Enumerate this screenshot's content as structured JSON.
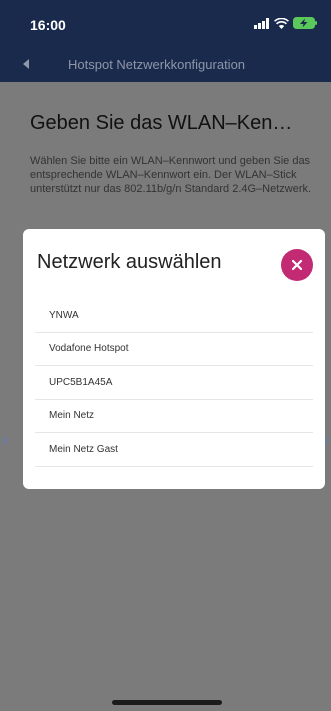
{
  "status_bar": {
    "time": "16:00",
    "icons": [
      "signal-icon",
      "wifi-icon",
      "battery-charging-icon"
    ]
  },
  "header": {
    "title": "Hotspot Netzwerkkonfiguration",
    "back_icon": "back-arrow-icon"
  },
  "page": {
    "heading": "Geben Sie das WLAN–Ken…",
    "description": "Wählen Sie bitte ein WLAN–Kennwort und geben Sie das entsprechende WLAN–Kennwort ein. Der WLAN–Stick unterstützt nur das 802.11b/g/n Standard 2.4G–Netzwerk."
  },
  "modal": {
    "title": "Netzwerk auswählen",
    "close_icon": "close-icon",
    "networks": [
      "YNWA",
      "Vodafone Hotspot",
      "UPC5B1A45A",
      "Mein Netz",
      "Mein Netz Gast"
    ]
  },
  "colors": {
    "nav_bg": "#1a2a4d",
    "overlay_bg": "#7b7b7b",
    "accent": "#c22a73",
    "modal_bg": "#ffffff"
  }
}
